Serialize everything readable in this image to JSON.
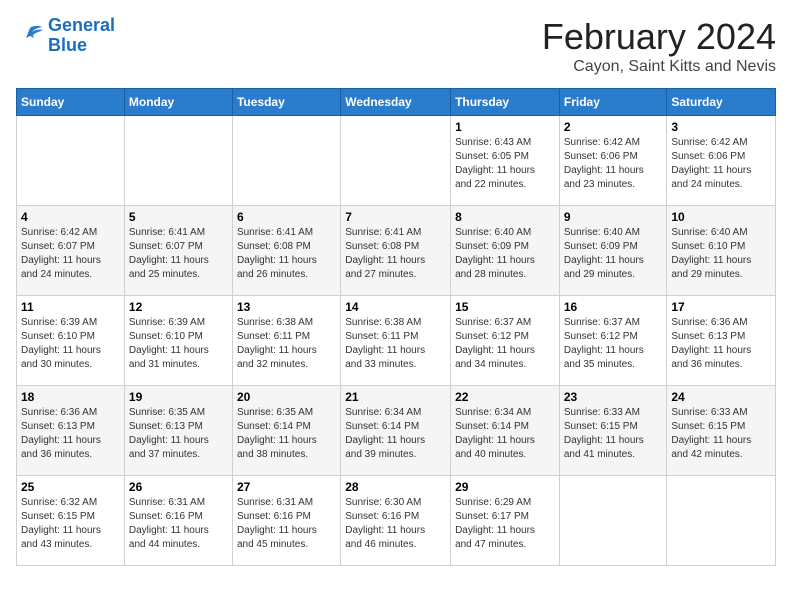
{
  "logo": {
    "line1": "General",
    "line2": "Blue"
  },
  "title": "February 2024",
  "subtitle": "Cayon, Saint Kitts and Nevis",
  "weekdays": [
    "Sunday",
    "Monday",
    "Tuesday",
    "Wednesday",
    "Thursday",
    "Friday",
    "Saturday"
  ],
  "weeks": [
    [
      {
        "day": "",
        "info": ""
      },
      {
        "day": "",
        "info": ""
      },
      {
        "day": "",
        "info": ""
      },
      {
        "day": "",
        "info": ""
      },
      {
        "day": "1",
        "info": "Sunrise: 6:43 AM\nSunset: 6:05 PM\nDaylight: 11 hours\nand 22 minutes."
      },
      {
        "day": "2",
        "info": "Sunrise: 6:42 AM\nSunset: 6:06 PM\nDaylight: 11 hours\nand 23 minutes."
      },
      {
        "day": "3",
        "info": "Sunrise: 6:42 AM\nSunset: 6:06 PM\nDaylight: 11 hours\nand 24 minutes."
      }
    ],
    [
      {
        "day": "4",
        "info": "Sunrise: 6:42 AM\nSunset: 6:07 PM\nDaylight: 11 hours\nand 24 minutes."
      },
      {
        "day": "5",
        "info": "Sunrise: 6:41 AM\nSunset: 6:07 PM\nDaylight: 11 hours\nand 25 minutes."
      },
      {
        "day": "6",
        "info": "Sunrise: 6:41 AM\nSunset: 6:08 PM\nDaylight: 11 hours\nand 26 minutes."
      },
      {
        "day": "7",
        "info": "Sunrise: 6:41 AM\nSunset: 6:08 PM\nDaylight: 11 hours\nand 27 minutes."
      },
      {
        "day": "8",
        "info": "Sunrise: 6:40 AM\nSunset: 6:09 PM\nDaylight: 11 hours\nand 28 minutes."
      },
      {
        "day": "9",
        "info": "Sunrise: 6:40 AM\nSunset: 6:09 PM\nDaylight: 11 hours\nand 29 minutes."
      },
      {
        "day": "10",
        "info": "Sunrise: 6:40 AM\nSunset: 6:10 PM\nDaylight: 11 hours\nand 29 minutes."
      }
    ],
    [
      {
        "day": "11",
        "info": "Sunrise: 6:39 AM\nSunset: 6:10 PM\nDaylight: 11 hours\nand 30 minutes."
      },
      {
        "day": "12",
        "info": "Sunrise: 6:39 AM\nSunset: 6:10 PM\nDaylight: 11 hours\nand 31 minutes."
      },
      {
        "day": "13",
        "info": "Sunrise: 6:38 AM\nSunset: 6:11 PM\nDaylight: 11 hours\nand 32 minutes."
      },
      {
        "day": "14",
        "info": "Sunrise: 6:38 AM\nSunset: 6:11 PM\nDaylight: 11 hours\nand 33 minutes."
      },
      {
        "day": "15",
        "info": "Sunrise: 6:37 AM\nSunset: 6:12 PM\nDaylight: 11 hours\nand 34 minutes."
      },
      {
        "day": "16",
        "info": "Sunrise: 6:37 AM\nSunset: 6:12 PM\nDaylight: 11 hours\nand 35 minutes."
      },
      {
        "day": "17",
        "info": "Sunrise: 6:36 AM\nSunset: 6:13 PM\nDaylight: 11 hours\nand 36 minutes."
      }
    ],
    [
      {
        "day": "18",
        "info": "Sunrise: 6:36 AM\nSunset: 6:13 PM\nDaylight: 11 hours\nand 36 minutes."
      },
      {
        "day": "19",
        "info": "Sunrise: 6:35 AM\nSunset: 6:13 PM\nDaylight: 11 hours\nand 37 minutes."
      },
      {
        "day": "20",
        "info": "Sunrise: 6:35 AM\nSunset: 6:14 PM\nDaylight: 11 hours\nand 38 minutes."
      },
      {
        "day": "21",
        "info": "Sunrise: 6:34 AM\nSunset: 6:14 PM\nDaylight: 11 hours\nand 39 minutes."
      },
      {
        "day": "22",
        "info": "Sunrise: 6:34 AM\nSunset: 6:14 PM\nDaylight: 11 hours\nand 40 minutes."
      },
      {
        "day": "23",
        "info": "Sunrise: 6:33 AM\nSunset: 6:15 PM\nDaylight: 11 hours\nand 41 minutes."
      },
      {
        "day": "24",
        "info": "Sunrise: 6:33 AM\nSunset: 6:15 PM\nDaylight: 11 hours\nand 42 minutes."
      }
    ],
    [
      {
        "day": "25",
        "info": "Sunrise: 6:32 AM\nSunset: 6:15 PM\nDaylight: 11 hours\nand 43 minutes."
      },
      {
        "day": "26",
        "info": "Sunrise: 6:31 AM\nSunset: 6:16 PM\nDaylight: 11 hours\nand 44 minutes."
      },
      {
        "day": "27",
        "info": "Sunrise: 6:31 AM\nSunset: 6:16 PM\nDaylight: 11 hours\nand 45 minutes."
      },
      {
        "day": "28",
        "info": "Sunrise: 6:30 AM\nSunset: 6:16 PM\nDaylight: 11 hours\nand 46 minutes."
      },
      {
        "day": "29",
        "info": "Sunrise: 6:29 AM\nSunset: 6:17 PM\nDaylight: 11 hours\nand 47 minutes."
      },
      {
        "day": "",
        "info": ""
      },
      {
        "day": "",
        "info": ""
      }
    ]
  ]
}
